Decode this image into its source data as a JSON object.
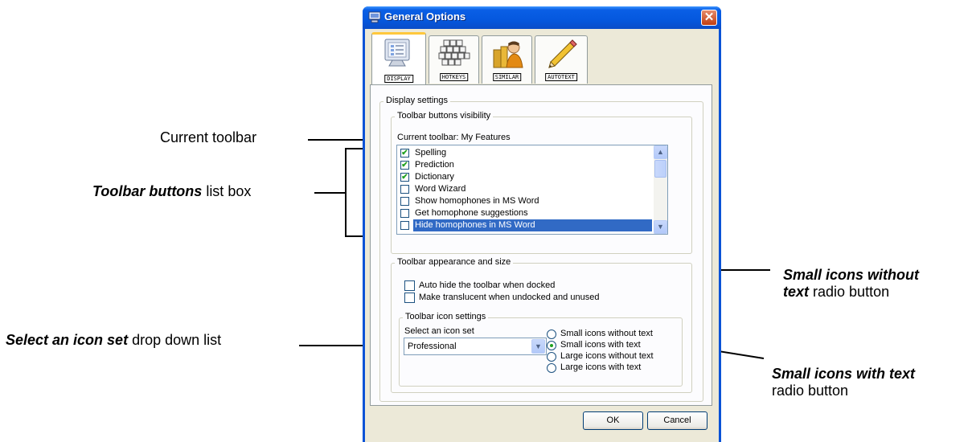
{
  "annotations": {
    "current_toolbar": "Current toolbar",
    "toolbar_buttons_bold": "Toolbar buttons",
    "toolbar_buttons_rest": " list box",
    "select_icon_set_bold": "Select an icon set",
    "select_icon_set_rest": " drop down list",
    "small_no_text_bold_1": "Small icons without",
    "small_no_text_bold_2": "text",
    "small_no_text_rest": " radio button",
    "small_with_text_bold": "Small icons with text",
    "small_with_text_rest": "radio button"
  },
  "window": {
    "title": "General Options",
    "close_glyph": "✕"
  },
  "tabs": [
    {
      "label": "DISPLAY",
      "icon": "monitor-icon",
      "active": true
    },
    {
      "label": "HOTKEYS",
      "icon": "keyboard-icon",
      "active": false
    },
    {
      "label": "SIMILAR",
      "icon": "person-books-icon",
      "active": false
    },
    {
      "label": "AUTOTEXT",
      "icon": "pencil-icon",
      "active": false
    }
  ],
  "display_settings": {
    "legend": "Display settings",
    "visibility": {
      "legend": "Toolbar buttons visibility",
      "current_toolbar_label": "Current toolbar: My Features",
      "items": [
        {
          "label": "Spelling",
          "checked": "✔"
        },
        {
          "label": "Prediction",
          "checked": "✔"
        },
        {
          "label": "Dictionary",
          "checked": "✔"
        },
        {
          "label": "Word Wizard",
          "checked": ""
        },
        {
          "label": "Show homophones in MS Word",
          "checked": ""
        },
        {
          "label": "Get homophone suggestions",
          "checked": ""
        },
        {
          "label": "Hide homophones in MS Word",
          "checked": "",
          "selected": true
        }
      ]
    },
    "appearance": {
      "legend": "Toolbar appearance and size",
      "auto_hide": "Auto hide the toolbar when docked",
      "translucent": "Make translucent when undocked and unused",
      "icon_settings": {
        "legend": "Toolbar icon settings",
        "select_label": "Select an icon set",
        "select_value": "Professional",
        "radios": [
          {
            "label": "Small icons without text",
            "selected": false
          },
          {
            "label": "Small icons with text",
            "selected": true
          },
          {
            "label": "Large icons without text",
            "selected": false
          },
          {
            "label": "Large icons with text",
            "selected": false
          }
        ]
      }
    }
  },
  "buttons": {
    "ok": "OK",
    "cancel": "Cancel"
  },
  "colors": {
    "title_bar": "#0558de",
    "selection": "#316ac5",
    "check": "#21a121"
  }
}
